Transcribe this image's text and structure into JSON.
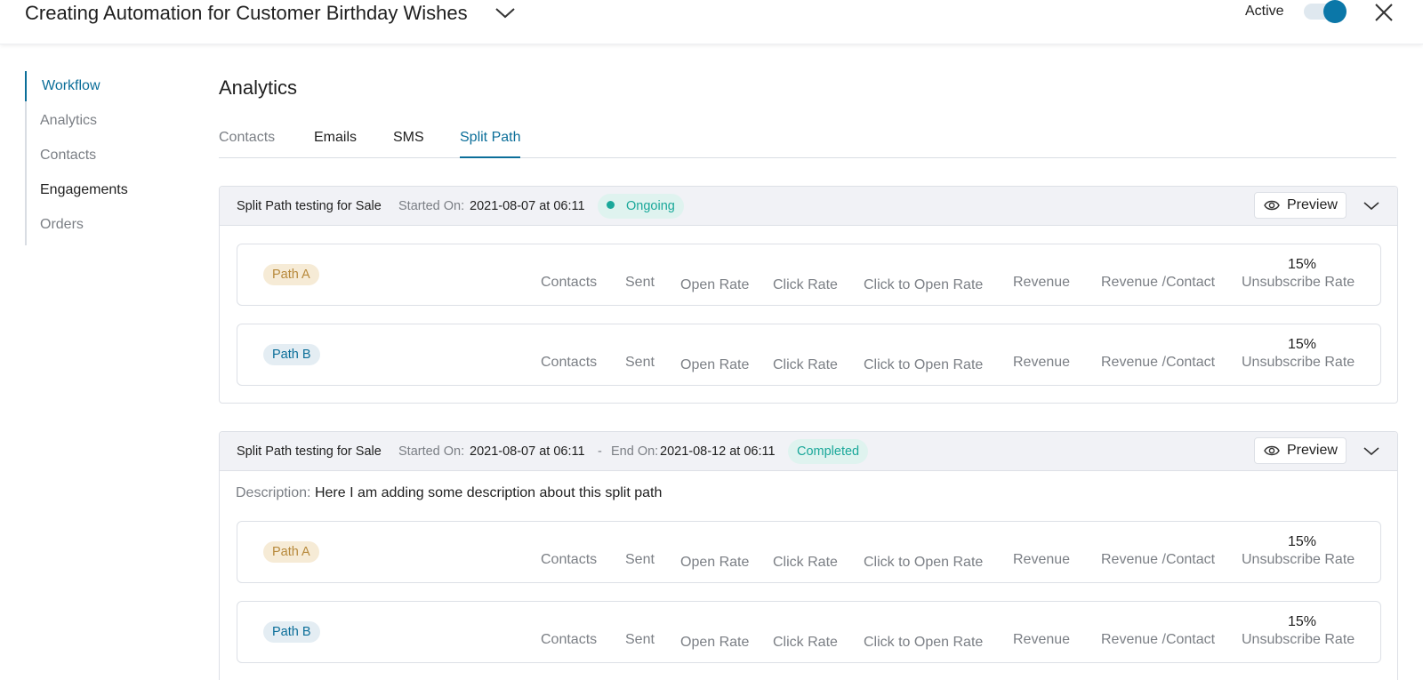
{
  "header": {
    "title": "Creating Automation for Customer Birthday Wishes",
    "active_label": "Active",
    "toggle_on": true
  },
  "sidebar": {
    "items": [
      {
        "label": "Workflow",
        "state": "active"
      },
      {
        "label": "Analytics",
        "state": "normal"
      },
      {
        "label": "Contacts",
        "state": "normal"
      },
      {
        "label": "Engagements",
        "state": "emphasis"
      },
      {
        "label": "Orders",
        "state": "normal"
      }
    ]
  },
  "main": {
    "title": "Analytics",
    "tabs": [
      {
        "label": "Contacts",
        "state": "normal"
      },
      {
        "label": "Emails",
        "state": "emphasis"
      },
      {
        "label": "SMS",
        "state": "emphasis"
      },
      {
        "label": "Split Path",
        "state": "active"
      }
    ]
  },
  "metric_labels": {
    "contacts": "Contacts",
    "sent": "Sent",
    "open_rate": "Open Rate",
    "click_rate": "Click Rate",
    "click_to_open": "Click to Open Rate",
    "revenue": "Revenue",
    "revenue_per_contact": "Revenue /Contact",
    "unsubscribe_rate": "Unsubscribe Rate"
  },
  "cards": [
    {
      "title": "Split Path testing for Sale",
      "started_label": "Started On:",
      "started_value": "2021-08-07 at 06:11",
      "status": "Ongoing",
      "preview_label": "Preview",
      "paths": [
        {
          "label": "Path A",
          "unsubscribe_value": "15%"
        },
        {
          "label": "Path B",
          "unsubscribe_value": "15%"
        }
      ]
    },
    {
      "title": "Split Path testing for Sale",
      "started_label": "Started On:",
      "started_value": "2021-08-07 at 06:11",
      "separator": "-",
      "end_label": "End On:",
      "end_value": "2021-08-12 at 06:11",
      "status": "Completed",
      "preview_label": "Preview",
      "description_label": "Description:",
      "description_value": "Here I am adding some description about this split path",
      "paths": [
        {
          "label": "Path A",
          "unsubscribe_value": "15%"
        },
        {
          "label": "Path B",
          "unsubscribe_value": "15%"
        }
      ]
    }
  ],
  "colors": {
    "accent": "#0b6e99",
    "status_green": "#1aa89a",
    "path_a": "#b7893b",
    "path_b": "#0b6e99"
  }
}
